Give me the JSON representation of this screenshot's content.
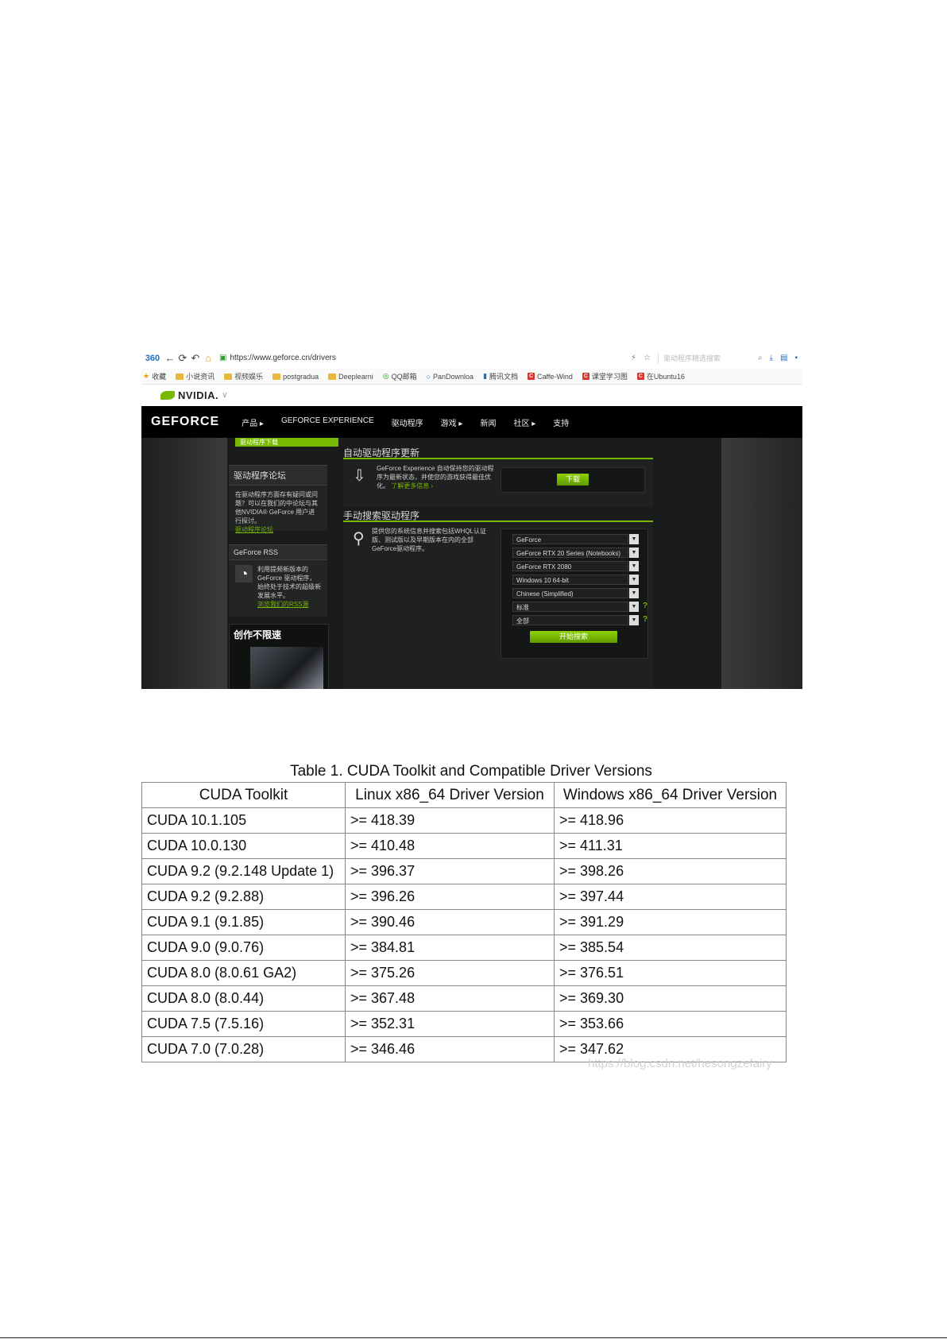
{
  "browser": {
    "url": "https://www.geforce.cn/drivers",
    "search_placeholder": "驱动程序精选搜索",
    "bookmarks": [
      "收藏",
      "小说资讯",
      "视频娱乐",
      "postgradua",
      "Deeplearni",
      "QQ邮箱",
      "PanDownloa",
      "腾讯文档",
      "Caffe-Wind",
      "课堂学习图",
      "在Ubuntu16"
    ]
  },
  "nvidia": {
    "logo_text": "NVIDIA."
  },
  "geforce_nav": {
    "brand": "GEFORCE",
    "items": [
      "产品 ▸",
      "GEFORCE EXPERIENCE",
      "驱动程序",
      "游戏 ▸",
      "新闻",
      "社区 ▸",
      "支持"
    ]
  },
  "sidebar": {
    "tab": "驱动程序下载",
    "forum_title": "驱动程序论坛",
    "forum_text": "在驱动程序方面存有疑问或问题？可以在我们的中论坛与其他NVIDIA® GeForce 用户进行探讨。",
    "forum_link": "驱动程序论坛",
    "rss_title": "GeForce RSS",
    "rss_text": "利用提频新版本的GeForce 驱动程序，始终处于技术的超级新发展水平。",
    "rss_link": "浏览我们的RSS源",
    "promo_title": "创作不限速"
  },
  "auto_update": {
    "title": "自动驱动程序更新",
    "text": "GeForce Experience 自动保持您的驱动程序为最新状态，并使您的游戏获得最佳优化。",
    "link": "了解更多信息 ›",
    "download": "下载"
  },
  "manual_search": {
    "title": "手动搜索驱动程序",
    "text": "提供您的系统信息并搜索包括WHQL认证版、测试版以及早期版本在内的全部GeForce驱动程序。",
    "selects": [
      "GeForce",
      "GeForce RTX 20 Series (Notebooks)",
      "GeForce RTX 2080",
      "Windows 10 64-bit",
      "Chinese (Simplified)",
      "标准",
      "全部"
    ],
    "search_button": "开始搜索"
  },
  "table": {
    "caption": "Table 1. CUDA Toolkit and Compatible Driver Versions",
    "headers": [
      "CUDA Toolkit",
      "Linux x86_64 Driver Version",
      "Windows x86_64 Driver Version"
    ],
    "rows": [
      [
        "CUDA 10.1.105",
        ">= 418.39",
        ">= 418.96"
      ],
      [
        "CUDA 10.0.130",
        ">= 410.48",
        ">= 411.31"
      ],
      [
        "CUDA 9.2 (9.2.148 Update 1)",
        ">= 396.37",
        ">= 398.26"
      ],
      [
        "CUDA 9.2 (9.2.88)",
        ">= 396.26",
        ">= 397.44"
      ],
      [
        "CUDA 9.1 (9.1.85)",
        ">= 390.46",
        ">= 391.29"
      ],
      [
        "CUDA 9.0 (9.0.76)",
        ">= 384.81",
        ">= 385.54"
      ],
      [
        "CUDA 8.0 (8.0.61 GA2)",
        ">= 375.26",
        ">= 376.51"
      ],
      [
        "CUDA 8.0 (8.0.44)",
        ">= 367.48",
        ">= 369.30"
      ],
      [
        "CUDA 7.5 (7.5.16)",
        ">= 352.31",
        ">= 353.66"
      ],
      [
        "CUDA 7.0 (7.0.28)",
        ">= 346.46",
        ">= 347.62"
      ]
    ]
  },
  "watermark": "https://blog.csdn.net/hesongzefairy",
  "colors": {
    "accent": "#76b900",
    "nav_bg": "#000000",
    "page_bg": "#1a1b1b"
  }
}
